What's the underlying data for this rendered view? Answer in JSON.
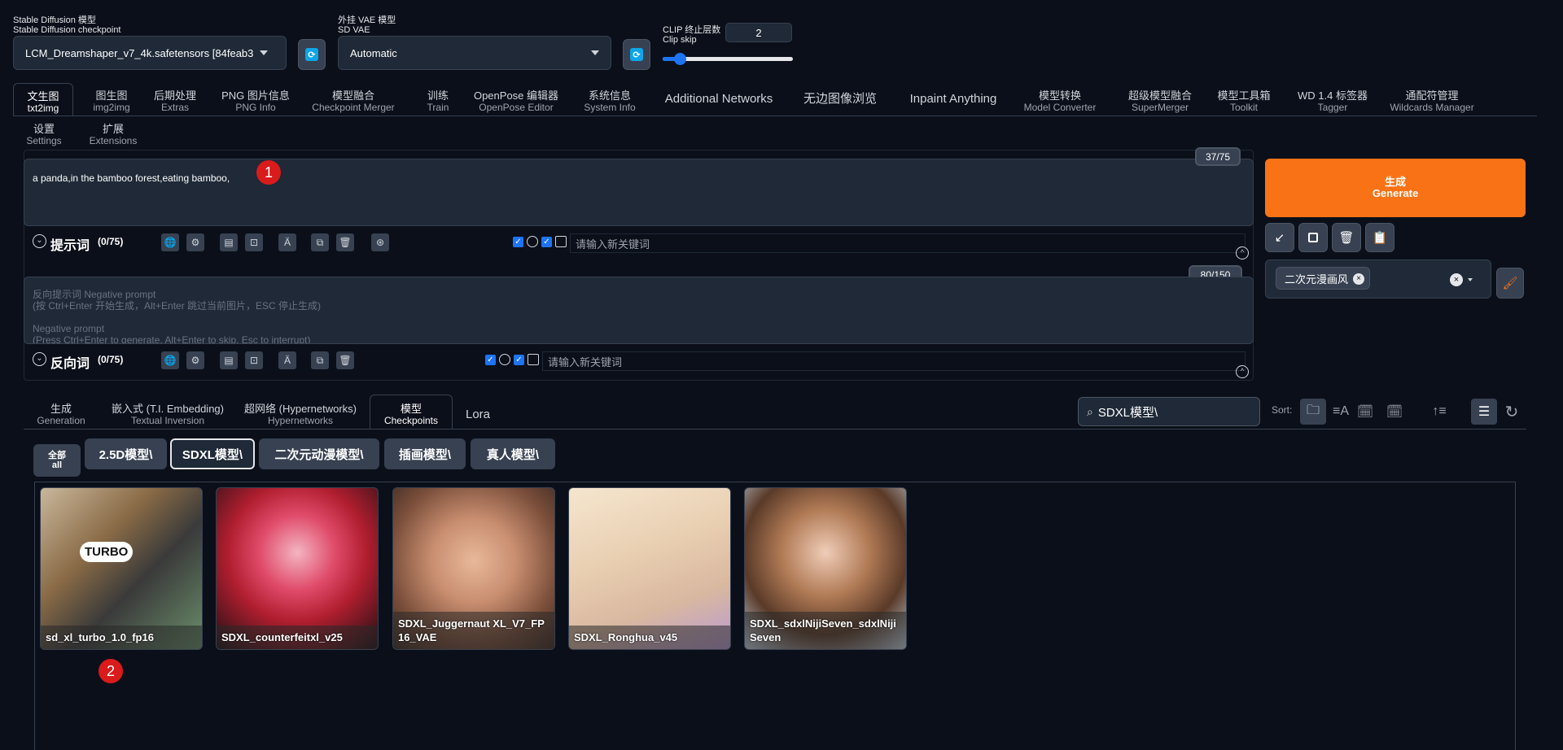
{
  "header": {
    "checkpoint_label_cn": "Stable Diffusion 模型",
    "checkpoint_label_en": "Stable Diffusion checkpoint",
    "checkpoint_value": "LCM_Dreamshaper_v7_4k.safetensors [84feab3",
    "vae_label_cn": "外挂 VAE 模型",
    "vae_label_en": "SD VAE",
    "vae_value": "Automatic",
    "clip_label_cn": "CLIP 终止层数",
    "clip_label_en": "Clip skip",
    "clip_value": "2",
    "clip_slider_fraction": 0.13
  },
  "tabs": [
    {
      "cn": "文生图",
      "en": "txt2img"
    },
    {
      "cn": "图生图",
      "en": "img2img"
    },
    {
      "cn": "后期处理",
      "en": "Extras"
    },
    {
      "cn": "PNG 图片信息",
      "en": "PNG Info"
    },
    {
      "cn": "模型融合",
      "en": "Checkpoint Merger"
    },
    {
      "cn": "训练",
      "en": "Train"
    },
    {
      "cn": "OpenPose 编辑器",
      "en": "OpenPose Editor"
    },
    {
      "cn": "系统信息",
      "en": "System Info"
    },
    {
      "cn": "Additional Networks",
      "en": ""
    },
    {
      "cn": "无边图像浏览",
      "en": ""
    },
    {
      "cn": "Inpaint Anything",
      "en": ""
    },
    {
      "cn": "模型转换",
      "en": "Model Converter"
    },
    {
      "cn": "超级模型融合",
      "en": "SuperMerger"
    },
    {
      "cn": "模型工具箱",
      "en": "Toolkit"
    },
    {
      "cn": "WD 1.4 标签器",
      "en": "Tagger"
    },
    {
      "cn": "通配符管理",
      "en": "Wildcards Manager"
    },
    {
      "cn": "设置",
      "en": "Settings"
    },
    {
      "cn": "扩展",
      "en": "Extensions"
    }
  ],
  "prompt": {
    "text": "a panda,in the bamboo forest,eating bamboo,",
    "counter": "37/75",
    "section_label": "提示词",
    "section_count": "(0/75)",
    "keyword_placeholder": "请输入新关键词"
  },
  "negative": {
    "placeholder": "反向提示词 Negative prompt\n(按 Ctrl+Enter 开始生成，Alt+Enter 跳过当前图片，ESC 停止生成)\n\nNegative prompt\n(Press Ctrl+Enter to generate, Alt+Enter to skip, Esc to interrupt)",
    "counter": "80/150",
    "section_label": "反向词",
    "section_count": "(0/75)",
    "keyword_placeholder": "请输入新关键词"
  },
  "generate": {
    "cn": "生成",
    "en": "Generate"
  },
  "style_tag": "二次元漫画风",
  "bottom_tabs": [
    {
      "cn": "生成",
      "en": "Generation"
    },
    {
      "cn": "嵌入式 (T.I. Embedding)",
      "en": "Textual Inversion"
    },
    {
      "cn": "超网络 (Hypernetworks)",
      "en": "Hypernetworks"
    },
    {
      "cn": "模型",
      "en": "Checkpoints"
    },
    {
      "cn": "Lora",
      "en": ""
    }
  ],
  "search": {
    "value": "SDXL模型\\"
  },
  "sort_label": "Sort:",
  "folders": {
    "all_cn": "全部",
    "all_en": "all",
    "items": [
      "2.5D模型\\",
      "SDXL模型\\",
      "二次元动漫模型\\",
      "插画模型\\",
      "真人模型\\"
    ]
  },
  "cards": [
    {
      "name": "sd_xl_turbo_1.0_fp16",
      "overlay": "TURBO"
    },
    {
      "name": "SDXL_counterfeitxl_v25"
    },
    {
      "name": "SDXL_Juggernaut XL_V7_FP16_VAE"
    },
    {
      "name": "SDXL_Ronghua_v45"
    },
    {
      "name": "SDXL_sdxlNijiSeven_sdxlNijiSeven"
    }
  ],
  "badges": [
    "1",
    "2"
  ],
  "colors": {
    "generate": "#f97316",
    "accent": "#1d74f5",
    "badge": "#d91b1b"
  }
}
